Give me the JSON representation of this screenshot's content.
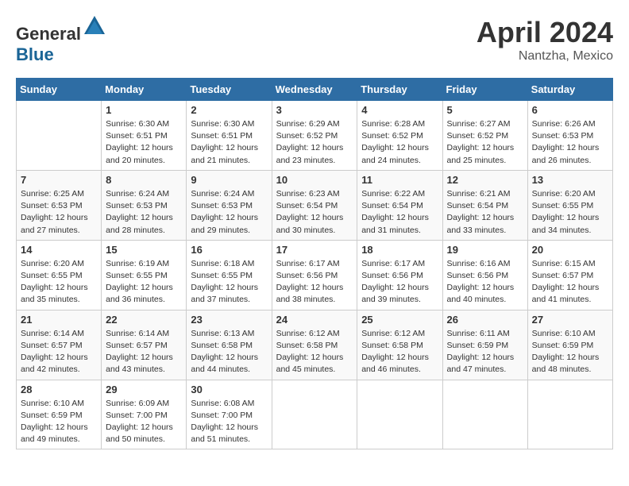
{
  "header": {
    "logo_general": "General",
    "logo_blue": "Blue",
    "month_year": "April 2024",
    "location": "Nantzha, Mexico"
  },
  "calendar": {
    "days_of_week": [
      "Sunday",
      "Monday",
      "Tuesday",
      "Wednesday",
      "Thursday",
      "Friday",
      "Saturday"
    ],
    "weeks": [
      [
        {
          "day": "",
          "sunrise": "",
          "sunset": "",
          "daylight": ""
        },
        {
          "day": "1",
          "sunrise": "Sunrise: 6:30 AM",
          "sunset": "Sunset: 6:51 PM",
          "daylight": "Daylight: 12 hours and 20 minutes."
        },
        {
          "day": "2",
          "sunrise": "Sunrise: 6:30 AM",
          "sunset": "Sunset: 6:51 PM",
          "daylight": "Daylight: 12 hours and 21 minutes."
        },
        {
          "day": "3",
          "sunrise": "Sunrise: 6:29 AM",
          "sunset": "Sunset: 6:52 PM",
          "daylight": "Daylight: 12 hours and 23 minutes."
        },
        {
          "day": "4",
          "sunrise": "Sunrise: 6:28 AM",
          "sunset": "Sunset: 6:52 PM",
          "daylight": "Daylight: 12 hours and 24 minutes."
        },
        {
          "day": "5",
          "sunrise": "Sunrise: 6:27 AM",
          "sunset": "Sunset: 6:52 PM",
          "daylight": "Daylight: 12 hours and 25 minutes."
        },
        {
          "day": "6",
          "sunrise": "Sunrise: 6:26 AM",
          "sunset": "Sunset: 6:53 PM",
          "daylight": "Daylight: 12 hours and 26 minutes."
        }
      ],
      [
        {
          "day": "7",
          "sunrise": "Sunrise: 6:25 AM",
          "sunset": "Sunset: 6:53 PM",
          "daylight": "Daylight: 12 hours and 27 minutes."
        },
        {
          "day": "8",
          "sunrise": "Sunrise: 6:24 AM",
          "sunset": "Sunset: 6:53 PM",
          "daylight": "Daylight: 12 hours and 28 minutes."
        },
        {
          "day": "9",
          "sunrise": "Sunrise: 6:24 AM",
          "sunset": "Sunset: 6:53 PM",
          "daylight": "Daylight: 12 hours and 29 minutes."
        },
        {
          "day": "10",
          "sunrise": "Sunrise: 6:23 AM",
          "sunset": "Sunset: 6:54 PM",
          "daylight": "Daylight: 12 hours and 30 minutes."
        },
        {
          "day": "11",
          "sunrise": "Sunrise: 6:22 AM",
          "sunset": "Sunset: 6:54 PM",
          "daylight": "Daylight: 12 hours and 31 minutes."
        },
        {
          "day": "12",
          "sunrise": "Sunrise: 6:21 AM",
          "sunset": "Sunset: 6:54 PM",
          "daylight": "Daylight: 12 hours and 33 minutes."
        },
        {
          "day": "13",
          "sunrise": "Sunrise: 6:20 AM",
          "sunset": "Sunset: 6:55 PM",
          "daylight": "Daylight: 12 hours and 34 minutes."
        }
      ],
      [
        {
          "day": "14",
          "sunrise": "Sunrise: 6:20 AM",
          "sunset": "Sunset: 6:55 PM",
          "daylight": "Daylight: 12 hours and 35 minutes."
        },
        {
          "day": "15",
          "sunrise": "Sunrise: 6:19 AM",
          "sunset": "Sunset: 6:55 PM",
          "daylight": "Daylight: 12 hours and 36 minutes."
        },
        {
          "day": "16",
          "sunrise": "Sunrise: 6:18 AM",
          "sunset": "Sunset: 6:55 PM",
          "daylight": "Daylight: 12 hours and 37 minutes."
        },
        {
          "day": "17",
          "sunrise": "Sunrise: 6:17 AM",
          "sunset": "Sunset: 6:56 PM",
          "daylight": "Daylight: 12 hours and 38 minutes."
        },
        {
          "day": "18",
          "sunrise": "Sunrise: 6:17 AM",
          "sunset": "Sunset: 6:56 PM",
          "daylight": "Daylight: 12 hours and 39 minutes."
        },
        {
          "day": "19",
          "sunrise": "Sunrise: 6:16 AM",
          "sunset": "Sunset: 6:56 PM",
          "daylight": "Daylight: 12 hours and 40 minutes."
        },
        {
          "day": "20",
          "sunrise": "Sunrise: 6:15 AM",
          "sunset": "Sunset: 6:57 PM",
          "daylight": "Daylight: 12 hours and 41 minutes."
        }
      ],
      [
        {
          "day": "21",
          "sunrise": "Sunrise: 6:14 AM",
          "sunset": "Sunset: 6:57 PM",
          "daylight": "Daylight: 12 hours and 42 minutes."
        },
        {
          "day": "22",
          "sunrise": "Sunrise: 6:14 AM",
          "sunset": "Sunset: 6:57 PM",
          "daylight": "Daylight: 12 hours and 43 minutes."
        },
        {
          "day": "23",
          "sunrise": "Sunrise: 6:13 AM",
          "sunset": "Sunset: 6:58 PM",
          "daylight": "Daylight: 12 hours and 44 minutes."
        },
        {
          "day": "24",
          "sunrise": "Sunrise: 6:12 AM",
          "sunset": "Sunset: 6:58 PM",
          "daylight": "Daylight: 12 hours and 45 minutes."
        },
        {
          "day": "25",
          "sunrise": "Sunrise: 6:12 AM",
          "sunset": "Sunset: 6:58 PM",
          "daylight": "Daylight: 12 hours and 46 minutes."
        },
        {
          "day": "26",
          "sunrise": "Sunrise: 6:11 AM",
          "sunset": "Sunset: 6:59 PM",
          "daylight": "Daylight: 12 hours and 47 minutes."
        },
        {
          "day": "27",
          "sunrise": "Sunrise: 6:10 AM",
          "sunset": "Sunset: 6:59 PM",
          "daylight": "Daylight: 12 hours and 48 minutes."
        }
      ],
      [
        {
          "day": "28",
          "sunrise": "Sunrise: 6:10 AM",
          "sunset": "Sunset: 6:59 PM",
          "daylight": "Daylight: 12 hours and 49 minutes."
        },
        {
          "day": "29",
          "sunrise": "Sunrise: 6:09 AM",
          "sunset": "Sunset: 7:00 PM",
          "daylight": "Daylight: 12 hours and 50 minutes."
        },
        {
          "day": "30",
          "sunrise": "Sunrise: 6:08 AM",
          "sunset": "Sunset: 7:00 PM",
          "daylight": "Daylight: 12 hours and 51 minutes."
        },
        {
          "day": "",
          "sunrise": "",
          "sunset": "",
          "daylight": ""
        },
        {
          "day": "",
          "sunrise": "",
          "sunset": "",
          "daylight": ""
        },
        {
          "day": "",
          "sunrise": "",
          "sunset": "",
          "daylight": ""
        },
        {
          "day": "",
          "sunrise": "",
          "sunset": "",
          "daylight": ""
        }
      ]
    ]
  }
}
